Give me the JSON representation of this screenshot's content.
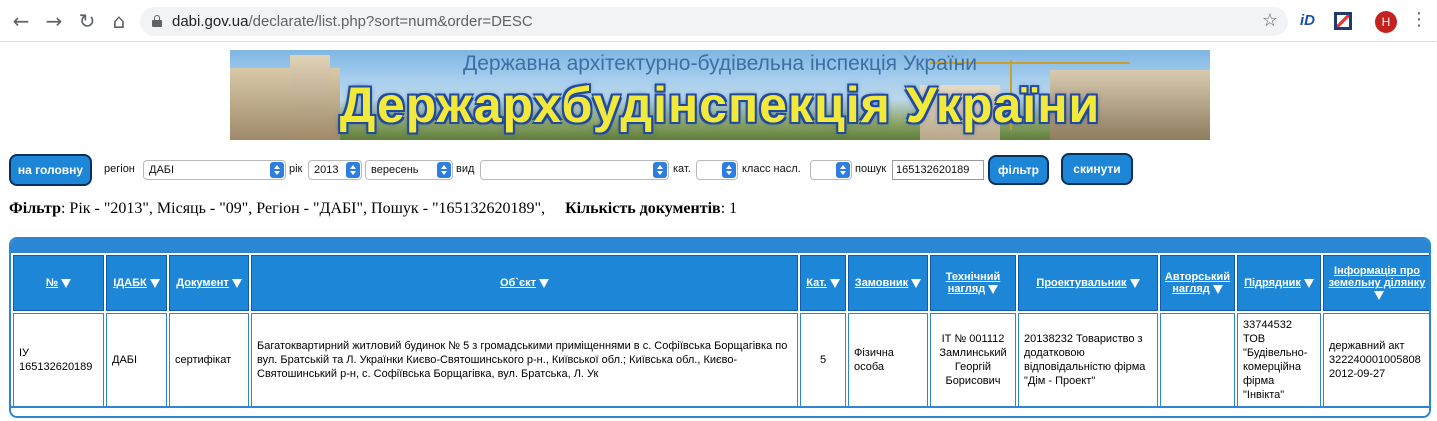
{
  "browser": {
    "url_host": "dabi.gov.ua",
    "url_path": "/declarate/list.php?sort=num&order=DESC",
    "avatar_letter": "H",
    "ext1_label": "iD"
  },
  "banner": {
    "subtitle": "Державна архітектурно-будівельна інспекція України",
    "title": "Держархбудінспекція України"
  },
  "filters": {
    "home_button": "на головну",
    "region_label": "регіон",
    "region_value": "ДАБІ",
    "year_label": "рік",
    "year_value": "2013",
    "month_value": "вересень",
    "type_label": "вид",
    "type_value": "",
    "cat_label": "кат.",
    "cat_value": "",
    "class_label": "класс насл.",
    "class_value": "",
    "search_label": "пошук",
    "search_value": "165132620189",
    "filter_button": "фільтр",
    "reset_button": "скинути"
  },
  "summary": {
    "filter_label": "Фільтр",
    "filter_text": ": Рік - \"2013\", Місяць - \"09\", Регіон - \"ДАБІ\", Пошук - \"165132620189\",",
    "count_label": "Кількість документів",
    "count_value": ": 1"
  },
  "table": {
    "headers": [
      "№",
      "ІДАБК",
      "Документ",
      "Об`єкт",
      "Кат.",
      "Замовник",
      "Технічний нагляд",
      "Проектувальник",
      "Авторський нагляд",
      "Підрядник",
      "Інформація про земельну ділянку"
    ],
    "row": {
      "num": "ІУ 165132620189",
      "idabk": "ДАБІ",
      "document": "сертифікат",
      "object": "Багатоквартирний житловий будинок № 5 з громадськими приміщеннями в с. Софіївська Борщагівка по вул. Братській та Л. Українки Києво-Святошинського р-н., Київської обл.; Київська обл., Києво-Святошинський р-н, с. Софіївська Борщагівка, вул. Братська, Л. Ук",
      "category": "5",
      "customer": "Фізична особа",
      "tech_supervision": "ІТ № 001112 Замлинський Георгій Борисович",
      "designer": "20138232 Товариство з додатковою відповідальністю фірма \"Дім - Проект\"",
      "author_supervision": "",
      "contractor": "33744532 ТОВ \"Будівельно-комерційна фірма \"Інвікта\"",
      "land_info": "державний акт 322240001005808 2012-09-27"
    }
  }
}
